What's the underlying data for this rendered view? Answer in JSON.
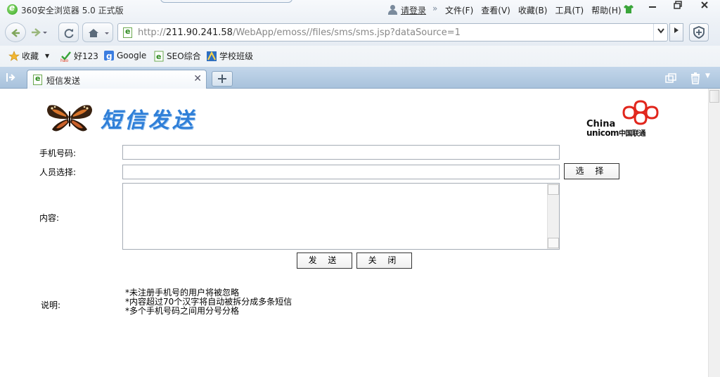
{
  "browser": {
    "title": "360安全浏览器 5.0 正式版",
    "login": "请登录",
    "menu": [
      "文件(F)",
      "查看(V)",
      "收藏(B)",
      "工具(T)",
      "帮助(H)"
    ],
    "url_prefix": "http://",
    "url_host": "211.90.241.58",
    "url_path": "/WebApp/emoss//files/sms/sms.jsp?dataSource=1",
    "favorites": [
      "收藏",
      "好123",
      "Google",
      "SEO综合",
      "学校班级"
    ],
    "tab_title": "短信发送",
    "colors": {
      "accent": "#2f7fd8",
      "tabbar": "#b4cbe2"
    }
  },
  "page": {
    "banner_title": "短信发送",
    "logo": {
      "line1": "China",
      "line2": "unicom",
      "cn": "中国联通"
    },
    "form": {
      "phone_label": "手机号码:",
      "person_label": "人员选择:",
      "content_label": "内容:",
      "phone_value": "",
      "person_value": "",
      "content_value": "",
      "select_button": "选 择",
      "send_button": "发 送",
      "close_button": "关 闭"
    },
    "notes": {
      "label": "说明:",
      "lines": [
        "*未注册手机号的用户将被忽略",
        "*内容超过70个汉字将自动被拆分成多条短信",
        "*多个手机号码之间用分号分格"
      ]
    }
  }
}
